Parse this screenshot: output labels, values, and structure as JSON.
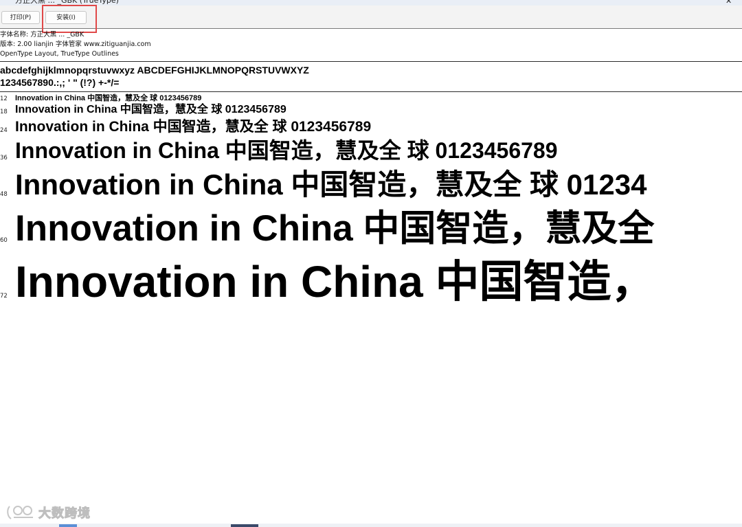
{
  "window": {
    "title": "方正大黑 ... _GBK (TrueType)"
  },
  "toolbar": {
    "print_label": "打印(P)",
    "install_label": "安装(I)"
  },
  "font_info": {
    "name_line": "字体名称: 方正大黑 ... _GBK",
    "version_line": "版本: 2.00 lianjin 字体管家 www.zitiguanjia.com",
    "type_line": "OpenType Layout, TrueType Outlines"
  },
  "charset": {
    "line1": "abcdefghijklmnopqrstuvwxyz ABCDEFGHIJKLMNOPQRSTUVWXYZ",
    "line2": "1234567890.:,; ' \" (!?) +-*/="
  },
  "samples": [
    {
      "size": "12",
      "text": "Innovation in China 中国智造，慧及全 球 0123456789"
    },
    {
      "size": "18",
      "text": "Innovation in China 中国智造，慧及全 球 0123456789"
    },
    {
      "size": "24",
      "text": "Innovation in China 中国智造，慧及全 球 0123456789"
    },
    {
      "size": "36",
      "text": "Innovation in China 中国智造，慧及全 球 0123456789"
    },
    {
      "size": "48",
      "text": "Innovation in China 中国智造，慧及全 球 01234"
    },
    {
      "size": "60",
      "text": "Innovation in China 中国智造，慧及全"
    },
    {
      "size": "72",
      "text": "Innovation in China 中国智造，"
    }
  ],
  "watermark": {
    "text": "大数跨境"
  },
  "colors": {
    "highlight": "#e04848"
  }
}
